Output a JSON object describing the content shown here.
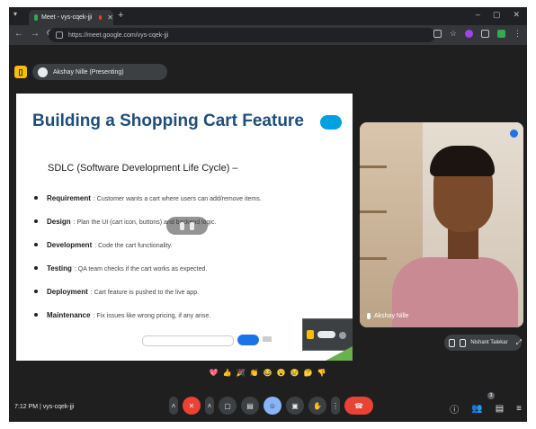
{
  "browser": {
    "tab_title": "Meet - vys-cqek-jji",
    "url": "https://meet.google.com/vys-cqek-jji",
    "new_tab_icon": "plus-icon",
    "window_controls": [
      "–",
      "▢",
      "✕"
    ]
  },
  "meet": {
    "presenter_label": "Akshay Nille (Presenting)",
    "meeting_code": "vys-cqek-jji",
    "time": "7:12 PM",
    "participant_count": "3"
  },
  "slide": {
    "title": "Building a Shopping Cart Feature",
    "subtitle": "SDLC (Software Development Life Cycle) –",
    "bullets": [
      {
        "label": "Requirement",
        "text": ": Customer wants a cart where users can add/remove items."
      },
      {
        "label": "Design",
        "text": ": Plan the UI (cart icon, buttons) and backend logic."
      },
      {
        "label": "Development",
        "text": ": Code the cart functionality."
      },
      {
        "label": "Testing",
        "text": ": QA team checks if the cart works as expected."
      },
      {
        "label": "Deployment",
        "text": ": Cart feature is pushed to the live app."
      },
      {
        "label": "Maintenance",
        "text": ": Fix issues like wrong pricing, if any arise."
      }
    ]
  },
  "tiles": {
    "main_participant": "Akshay Nille",
    "self_view": "Nishant Talekar"
  },
  "colors": {
    "meet_bg": "#1f1f1f",
    "slide_title": "#1f4e79",
    "end_call": "#ea4335",
    "accent": "#8ab4f8"
  },
  "reactions": [
    "💖",
    "👍",
    "🎉",
    "👏",
    "😂",
    "😮",
    "😢",
    "🤔",
    "👎"
  ]
}
